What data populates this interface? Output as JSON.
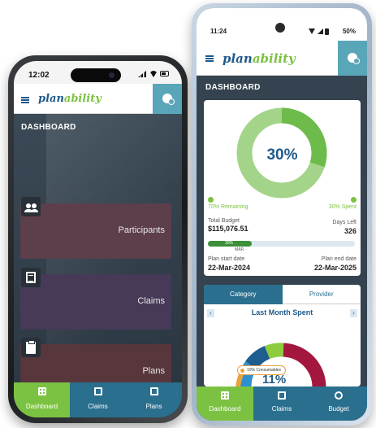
{
  "iphone": {
    "status_time": "12:02",
    "logo_plan": "plan",
    "logo_ability": "ability",
    "dashboard_title": "DASHBOARD",
    "tiles": [
      {
        "label": "Participants",
        "icon": "people-icon"
      },
      {
        "label": "Claims",
        "icon": "claims-document-icon"
      },
      {
        "label": "Plans",
        "icon": "clipboard-icon"
      }
    ],
    "nav": [
      {
        "label": "Dashboard",
        "active": true
      },
      {
        "label": "Claims",
        "active": false
      },
      {
        "label": "Plans",
        "active": false
      }
    ]
  },
  "android": {
    "status_time": "11:24",
    "battery": "50%",
    "logo_plan": "plan",
    "logo_ability": "ability",
    "dashboard_title": "DASHBOARD",
    "budget": {
      "spent_percent_label": "30%",
      "spent_fraction": 0.3,
      "remaining_label": "70% Remaining",
      "spent_label": "30% Spent",
      "total_budget_label": "Total Budget",
      "total_budget_value": "$115,076.51",
      "days_left_label": "Days Left",
      "days_left_value": "326",
      "progress_text": "30%",
      "progress_month": "MAR",
      "plan_start_label": "Plan start date",
      "plan_start_value": "22-Mar-2024",
      "plan_end_label": "Plan end date",
      "plan_end_value": "22-Mar-2025"
    },
    "tabs": [
      {
        "label": "Category",
        "active": true
      },
      {
        "label": "Provider",
        "active": false
      }
    ],
    "last_month": {
      "title": "Last Month Spent",
      "prev_arrow": "‹",
      "next_arrow": "›",
      "highlight_label": "10% Consumables",
      "highlight_value": "11%"
    },
    "nav": [
      {
        "label": "Dashboard",
        "active": true
      },
      {
        "label": "Claims",
        "active": false
      },
      {
        "label": "Budget",
        "active": false
      }
    ]
  },
  "colors": {
    "brand_blue": "#1f5a8a",
    "brand_green": "#7cc242",
    "nav_teal": "#2a6f8e",
    "accent_teal": "#5aa6b9",
    "donut_light_green": "#a4d48a",
    "donut_dark_green": "#6dbb4a"
  }
}
